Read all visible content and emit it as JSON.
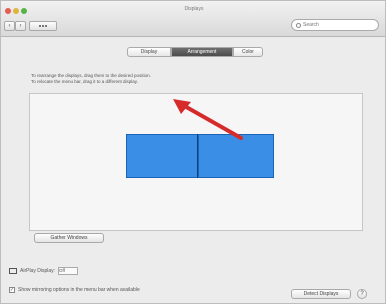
{
  "window": {
    "title": "Displays"
  },
  "toolbar": {
    "back_glyph": "‹",
    "forward_glyph": "›",
    "show_all_icon": "grid-icon",
    "search": {
      "placeholder": "Search",
      "value": ""
    }
  },
  "tabs": [
    {
      "label": "Display",
      "active": false
    },
    {
      "label": "Arrangement",
      "active": true
    },
    {
      "label": "Color",
      "active": false
    }
  ],
  "arrangement": {
    "instruction_line1": "To rearrange the displays, drag them to the desired position.",
    "instruction_line2": "To relocate the menu bar, drag it to a different display.",
    "displays": [
      {
        "name": "display-1",
        "color": "#3a8ee6"
      },
      {
        "name": "display-2",
        "color": "#3a8ee6"
      }
    ],
    "gather_button": "Gather Windows"
  },
  "footer": {
    "airplay_label": "AirPlay Display:",
    "airplay_value": "Off",
    "checkbox_label": "Show mirroring options in the menu bar when available",
    "checkbox_checked": true,
    "help_button": "Detect Displays",
    "question_glyph": "?"
  },
  "annotation": {
    "arrow_color": "#d62b2b"
  }
}
